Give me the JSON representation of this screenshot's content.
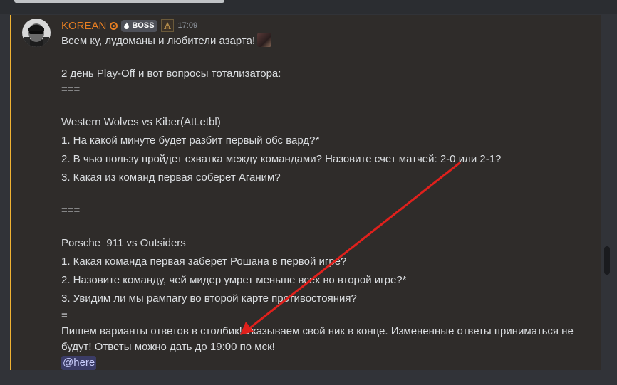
{
  "message": {
    "author": "KOREAN",
    "role_badge": "BOSS",
    "timestamp": "17:09",
    "lines": {
      "greeting": "Всем ку, лудоманы и любители азарта!",
      "intro": "2 день Play-Off и вот вопросы тотализатора:",
      "sep1": "===",
      "match1_title": "Western Wolves vs Kiber(AtLetbl)",
      "m1_q1": "1. На какой минуте будет разбит первый обс вард?*",
      "m1_q2": "2. В чью пользу пройдет схватка между командами? Назовите счет матчей: 2-0 или 2-1?",
      "m1_q3": "3. Какая из команд первая соберет Аганим?",
      "sep2": "===",
      "match2_title": "Porsche_911 vs Outsiders",
      "m2_q1": "1. Какая команда первая заберет Рошана в первой игре?",
      "m2_q2": "2. Назовите команду, чей мидер умрет меньше всех во второй игре?*",
      "m2_q3": "3. Увидим ли мы рампагу во второй карте противостояния?",
      "sep3": "=",
      "instructions": "Пишем варианты ответов в столбик! Указываем свой ник в конце. Измененные ответы приниматься не будут! Ответы можно дать до 19:00 по мск!",
      "mention": "@here"
    }
  },
  "icons": {
    "verified": "verified-icon",
    "flame": "flame-icon",
    "rank": "rank-icon",
    "emoji": "custom-emoji"
  },
  "colors": {
    "username": "#e67e22",
    "highlight_border": "#f0b232",
    "annotation_arrow": "#e0201c",
    "mention_bg": "#5865f24d"
  }
}
